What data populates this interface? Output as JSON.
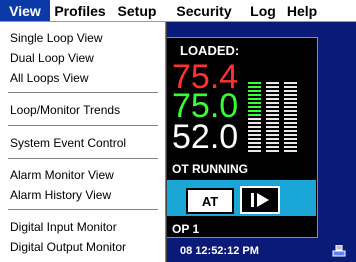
{
  "menubar": {
    "items": [
      "View",
      "Profiles",
      "Setup",
      "Security",
      "Log",
      "Help"
    ],
    "active": "View"
  },
  "dropdown": {
    "items": [
      "Single Loop View",
      "Dual Loop View",
      "All Loops View",
      "Loop/Monitor Trends",
      "System Event Control",
      "Alarm Monitor View",
      "Alarm History View",
      "Digital Input Monitor",
      "Digital Output Monitor"
    ]
  },
  "panel": {
    "loaded_label": "LOADED:",
    "value_1": "75.4",
    "value_2": "75.0",
    "value_3": "52.0",
    "status": "OT RUNNING",
    "at_button": "AT",
    "loop_label": "OP 1",
    "clock": "08 12:52:12 PM"
  },
  "colors": {
    "menu_active_bg": "#0b3aa8",
    "background": "#0a1a78",
    "value_red": "#ff3030",
    "value_green": "#33ff33",
    "button_bar": "#1aa6d6"
  }
}
